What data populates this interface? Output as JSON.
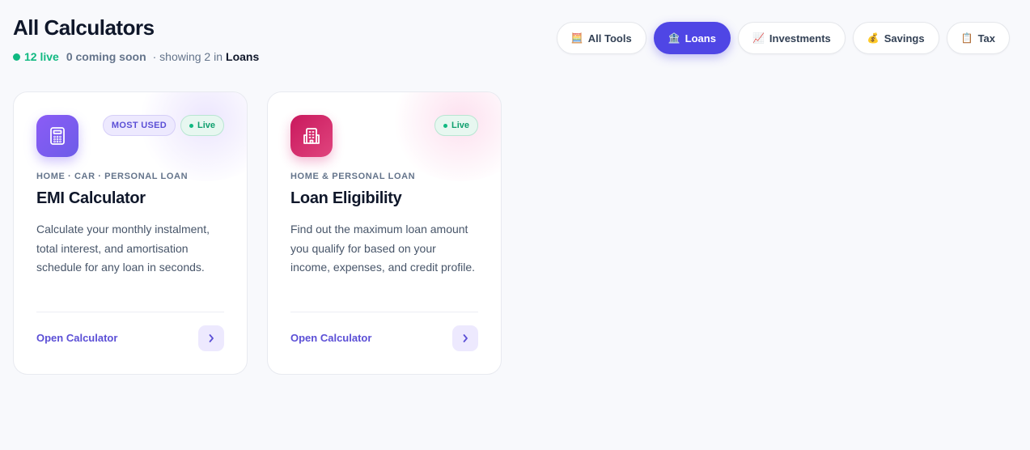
{
  "header": {
    "title": "All Calculators",
    "live_count": "12 live",
    "coming_soon": "0 coming soon",
    "showing_text": "· showing 2 in",
    "showing_category": "Loans"
  },
  "filters": [
    {
      "icon": "🧮",
      "icon_name": "abacus-icon",
      "label": "All Tools",
      "active": false
    },
    {
      "icon": "🏦",
      "icon_name": "bank-icon",
      "label": "Loans",
      "active": true
    },
    {
      "icon": "📈",
      "icon_name": "chart-increasing-icon",
      "label": "Investments",
      "active": false
    },
    {
      "icon": "💰",
      "icon_name": "money-bag-icon",
      "label": "Savings",
      "active": false
    },
    {
      "icon": "📋",
      "icon_name": "clipboard-icon",
      "label": "Tax",
      "active": false
    }
  ],
  "cards": [
    {
      "icon_name": "calculator-icon",
      "badge_most_used": "MOST USED",
      "badge_live": "Live",
      "category": "HOME · CAR · PERSONAL LOAN",
      "title": "EMI Calculator",
      "description": "Calculate your monthly instalment, total interest, and amortisation schedule for any loan in seconds.",
      "cta": "Open Calculator"
    },
    {
      "icon_name": "building-icon",
      "badge_live": "Live",
      "category": "HOME & PERSONAL LOAN",
      "title": "Loan Eligibility",
      "description": "Find out the maximum loan amount you qualify for based on your income, expenses, and credit profile.",
      "cta": "Open Calculator"
    }
  ],
  "colors": {
    "accent": "#4f46e5",
    "live_green": "#10b981",
    "emi_icon_bg": "#7c5cf6",
    "eligibility_icon_bg": "#db2777"
  }
}
